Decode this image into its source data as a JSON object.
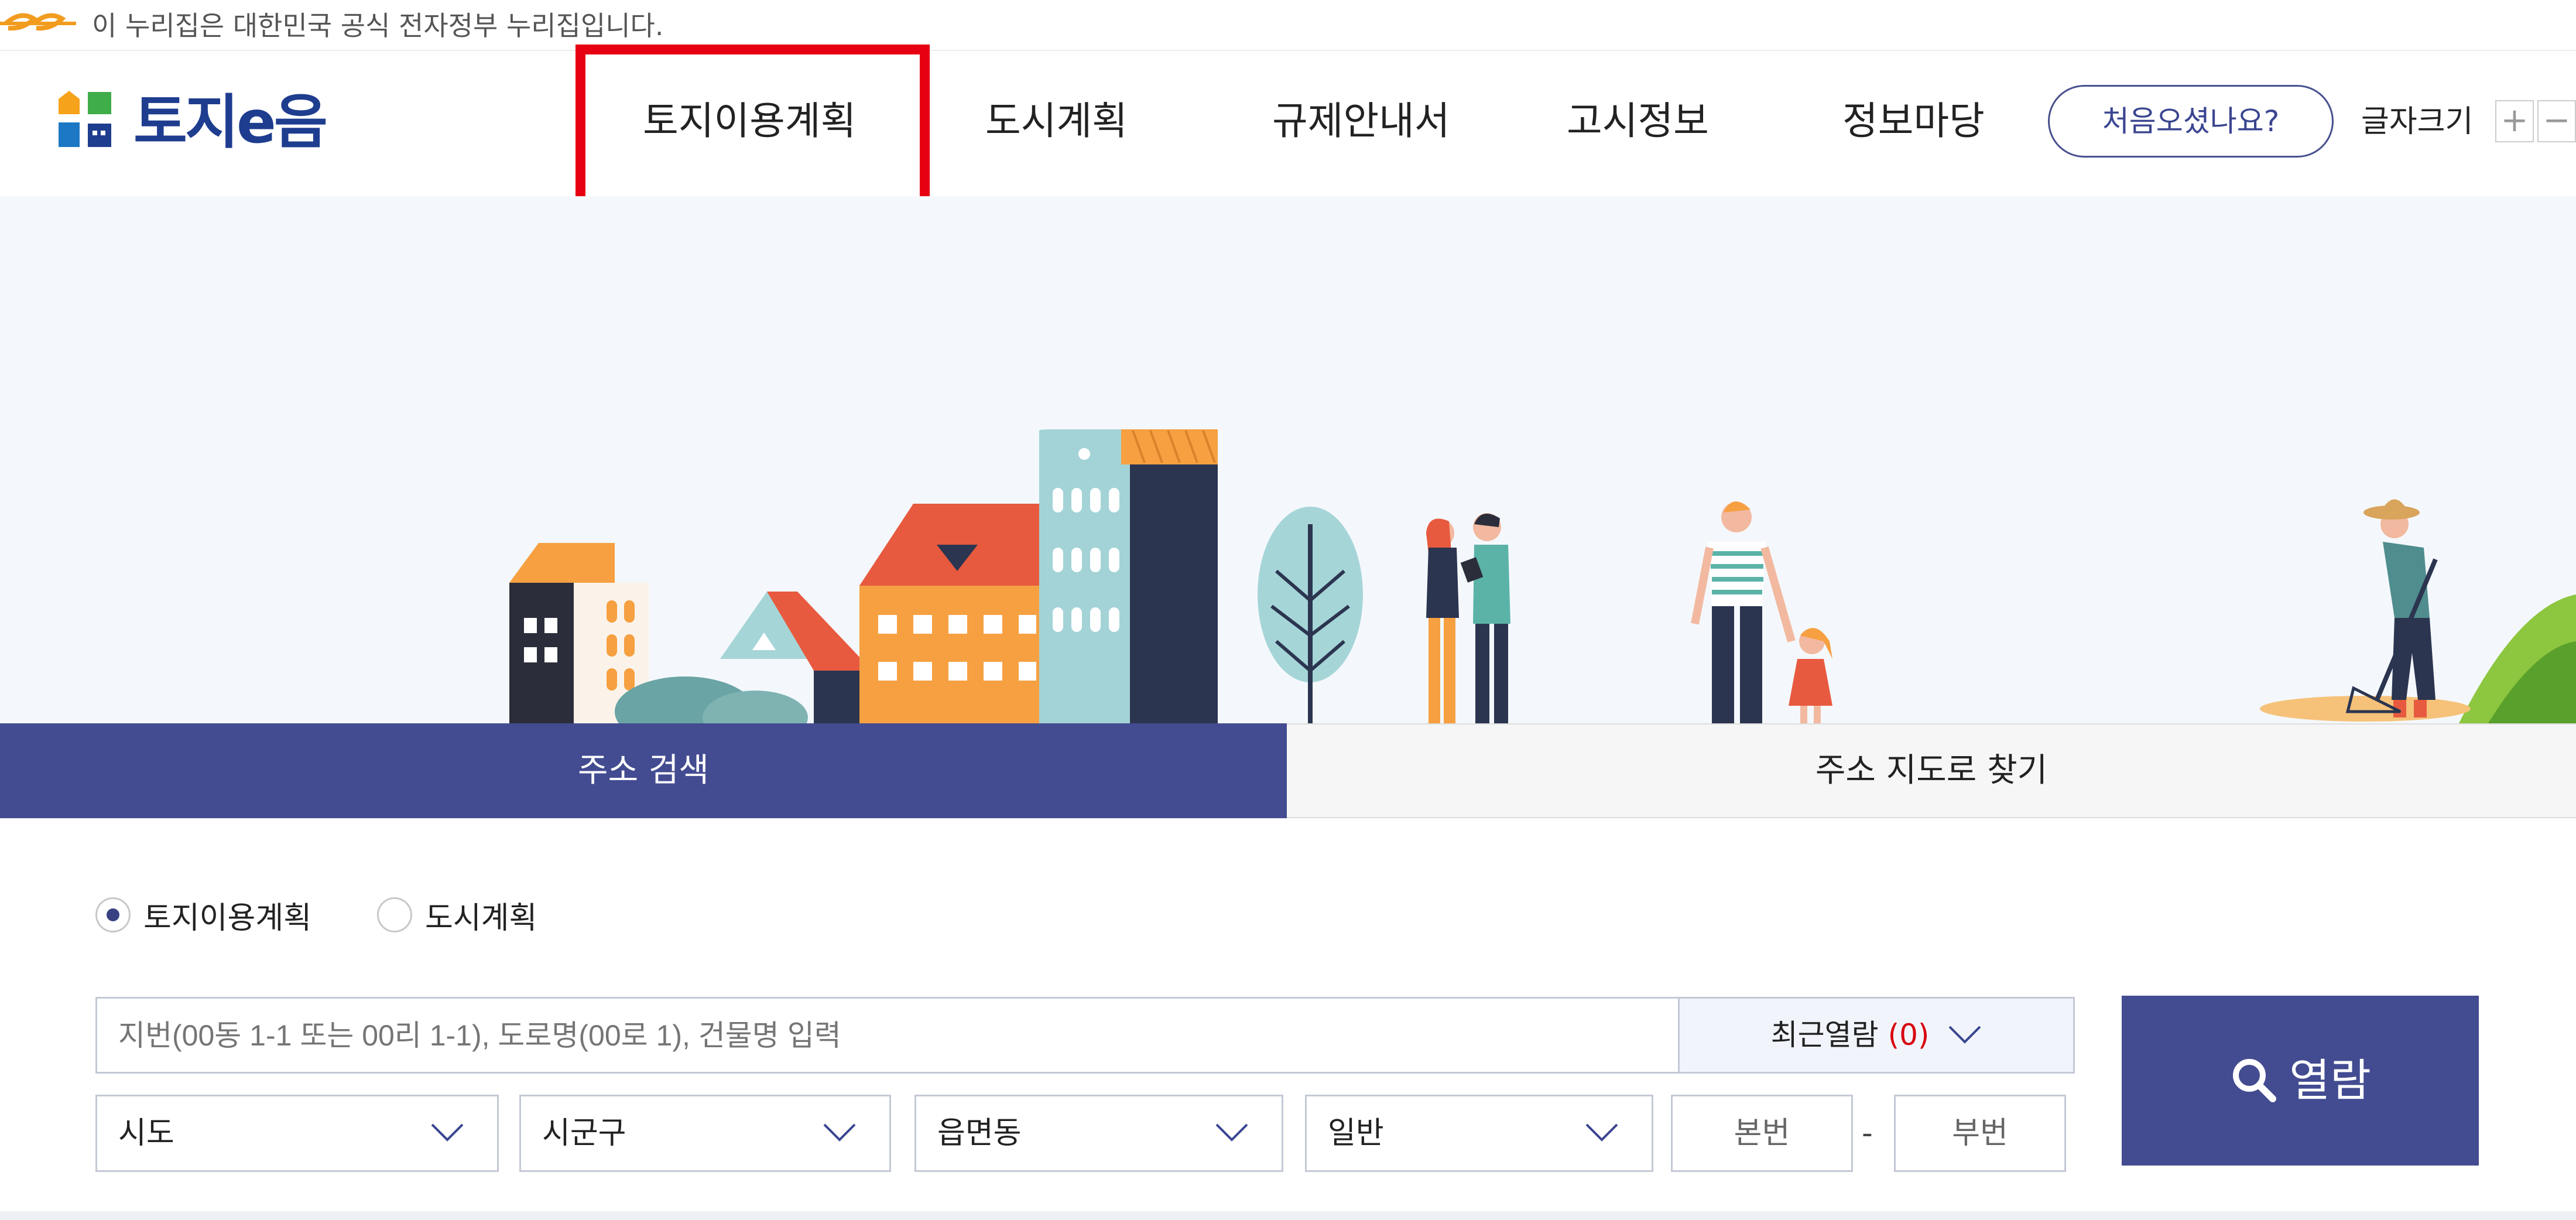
{
  "gov_banner": {
    "text": "이 누리집은 대한민국 공식 전자정부 누리집입니다."
  },
  "header": {
    "logo_text": "토지e음",
    "nav": [
      {
        "label": "토지이용계획"
      },
      {
        "label": "도시계획"
      },
      {
        "label": "규제안내서"
      },
      {
        "label": "고시정보"
      },
      {
        "label": "정보마당"
      }
    ],
    "help_button": "처음오셨나요?",
    "font_size_label": "글자크기",
    "font_plus": "+",
    "font_minus": "−"
  },
  "tabs": [
    {
      "label": "주소 검색",
      "active": true
    },
    {
      "label": "주소 지도로 찾기",
      "active": false
    }
  ],
  "search": {
    "radios": [
      {
        "label": "토지이용계획",
        "checked": true
      },
      {
        "label": "도시계획",
        "checked": false
      }
    ],
    "placeholder": "지번(00동 1-1 또는 00리 1-1), 도로명(00로 1), 건물명 입력",
    "recent_label": "최근열람",
    "recent_count": "(0)",
    "selects": [
      {
        "label": "시도"
      },
      {
        "label": "시군구"
      },
      {
        "label": "읍면동"
      },
      {
        "label": "일반"
      }
    ],
    "main_number_placeholder": "본번",
    "sub_number_placeholder": "부번",
    "dash": "-",
    "view_button": "열람"
  },
  "colors": {
    "brand_navy": "#434c91",
    "highlight_red": "#e60012",
    "hero_bg": "#f4f8fc",
    "recent_count": "#d7000f"
  }
}
